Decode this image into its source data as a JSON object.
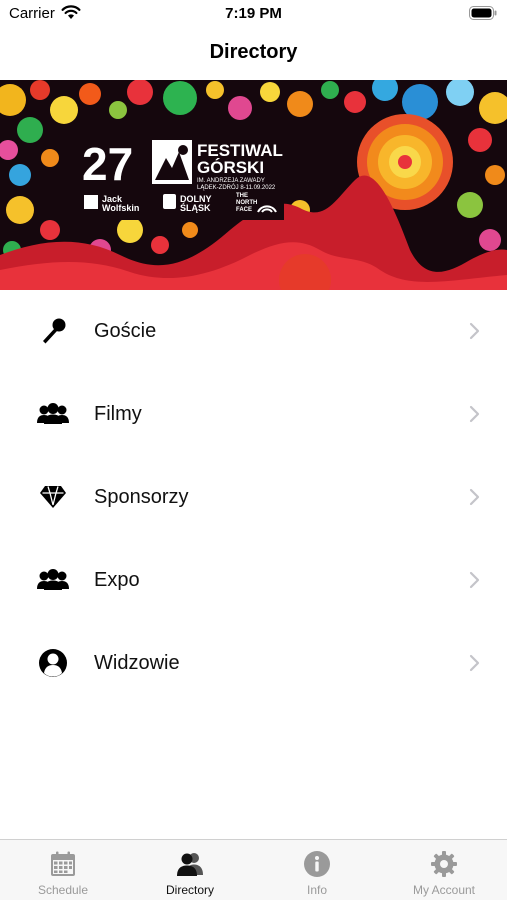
{
  "status_bar": {
    "carrier": "Carrier",
    "time": "7:19 PM",
    "icons": [
      "wifi-icon",
      "battery-icon"
    ]
  },
  "nav": {
    "title": "Directory"
  },
  "banner": {
    "number": "27",
    "title_line1": "FESTIWAL",
    "title_line2": "GÓRSKI",
    "subtitle_line1": "IM. ANDRZEJA ZAWADY",
    "subtitle_line2": "LĄDEK-ZDRÓJ 8-11.09.2022",
    "sponsor1_line1": "Jack",
    "sponsor1_line2": "Wolfskin",
    "sponsor2_line1": "DOLNY",
    "sponsor2_line2": "ŚLĄSK",
    "sponsor3_line1": "THE",
    "sponsor3_line2": "NORTH",
    "sponsor3_line3": "FACE"
  },
  "menu": {
    "items": [
      {
        "label": "Goście",
        "icon": "microphone-icon"
      },
      {
        "label": "Filmy",
        "icon": "people-group-icon"
      },
      {
        "label": "Sponsorzy",
        "icon": "diamond-icon"
      },
      {
        "label": "Expo",
        "icon": "people-group-icon"
      },
      {
        "label": "Widzowie",
        "icon": "user-circle-icon"
      }
    ]
  },
  "tab_bar": {
    "tabs": [
      {
        "label": "Schedule",
        "icon": "calendar-icon",
        "active": false
      },
      {
        "label": "Directory",
        "icon": "contacts-icon",
        "active": true
      },
      {
        "label": "Info",
        "icon": "info-icon",
        "active": false
      },
      {
        "label": "My Account",
        "icon": "gear-icon",
        "active": false
      }
    ]
  },
  "colors": {
    "active_tab": "#111111",
    "inactive_tab": "#9a9a9a",
    "chevron": "#c4c4c9",
    "tab_bar_bg": "#f7f7f7"
  }
}
